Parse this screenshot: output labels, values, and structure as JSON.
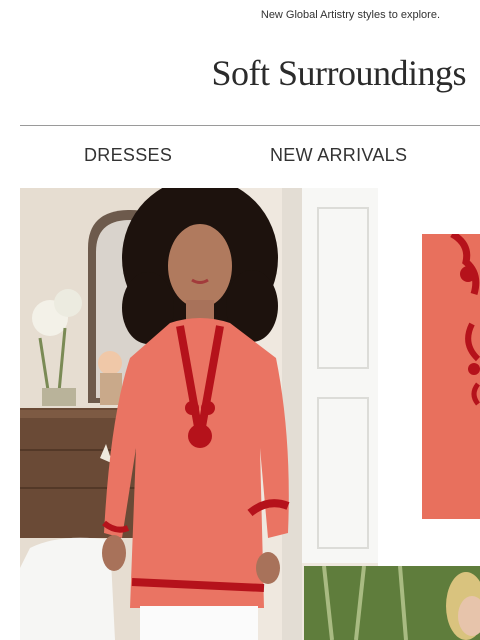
{
  "preheader": {
    "text": "New Global Artistry styles to explore."
  },
  "brand": {
    "logo_text": "Soft Surroundings"
  },
  "nav": {
    "items": [
      {
        "label": "DRESSES"
      },
      {
        "label": "NEW ARRIVALS"
      }
    ]
  },
  "colors": {
    "tunic_coral": "#ea7463",
    "embroidery_red": "#b5121b",
    "text": "#333333"
  },
  "images": {
    "hero": "woman-in-coral-embroidered-tunic-photo",
    "detail": "coral-tunic-embroidery-detail-photo",
    "secondary": "woman-in-garden-photo"
  }
}
